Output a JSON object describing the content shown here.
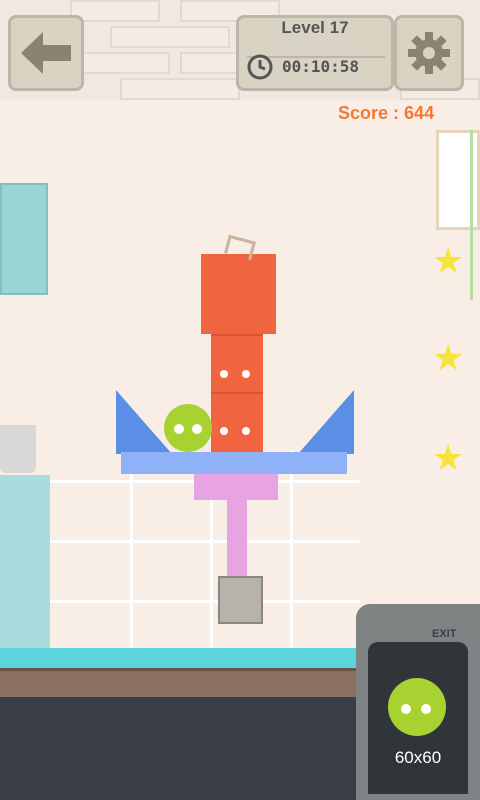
{
  "hud": {
    "level_label": "Level",
    "level_number": "17",
    "timer": "00:10:58",
    "score_label": "Score :",
    "score_value": "644"
  },
  "stars": {
    "count": 3
  },
  "exit": {
    "label": "EXIT",
    "ball_size": "60x60"
  },
  "colors": {
    "red_block": "#f0643f",
    "blue_triangle": "#5b8fe6",
    "green_ball": "#a8d232",
    "pink_block": "#e8a3e2",
    "plank": "#8fb1f7",
    "score": "#f07a34",
    "star": "#f6e43c"
  },
  "icons": [
    "back-arrow-icon",
    "clock-icon",
    "gear-icon",
    "star-icon"
  ]
}
